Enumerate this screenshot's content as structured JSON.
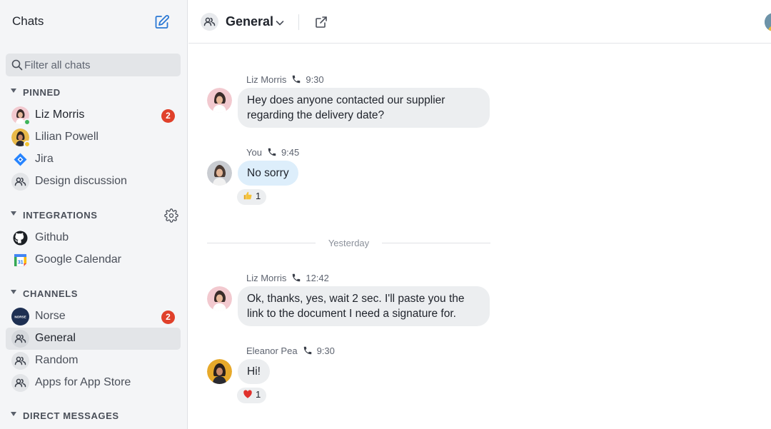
{
  "sidebar": {
    "title": "Chats",
    "search_placeholder": "Filter all chats",
    "sections": {
      "pinned": {
        "label": "PINNED",
        "items": [
          {
            "label": "Liz Morris",
            "badge": "2"
          },
          {
            "label": "Lilian Powell"
          },
          {
            "label": "Jira"
          },
          {
            "label": "Design discussion"
          }
        ]
      },
      "integrations": {
        "label": "INTEGRATIONS",
        "items": [
          {
            "label": "Github"
          },
          {
            "label": "Google Calendar",
            "icon_text": "31"
          }
        ]
      },
      "channels": {
        "label": "CHANNELS",
        "items": [
          {
            "label": "Norse",
            "badge": "2",
            "logo_text": "NORSE"
          },
          {
            "label": "General"
          },
          {
            "label": "Random"
          },
          {
            "label": "Apps for App Store"
          }
        ]
      },
      "direct_messages": {
        "label": "DIRECT MESSAGES"
      }
    }
  },
  "header": {
    "channel_name": "General"
  },
  "messages": [
    {
      "author": "Liz Morris",
      "time": "9:30",
      "text": "Hey does anyone contacted our supplier regarding the delivery date?"
    },
    {
      "author": "You",
      "time": "9:45",
      "text": "No sorry",
      "reaction": {
        "emoji": "thumbs-up",
        "count": "1"
      }
    },
    {
      "author": "Liz Morris",
      "time": "12:42",
      "text": "Ok, thanks, yes, wait 2 sec. I'll paste you the link to the document I need a signature for."
    },
    {
      "author": "Eleanor Pea",
      "time": "9:30",
      "text": "Hi!",
      "reaction": {
        "emoji": "heart",
        "count": "1"
      }
    }
  ],
  "day_separator": "Yesterday",
  "colors": {
    "badge": "#e0402a",
    "selected_bg": "#e3e5e8",
    "own_bubble": "#ddeefb",
    "other_bubble": "#eceef0",
    "accent": "#2a78d4"
  }
}
